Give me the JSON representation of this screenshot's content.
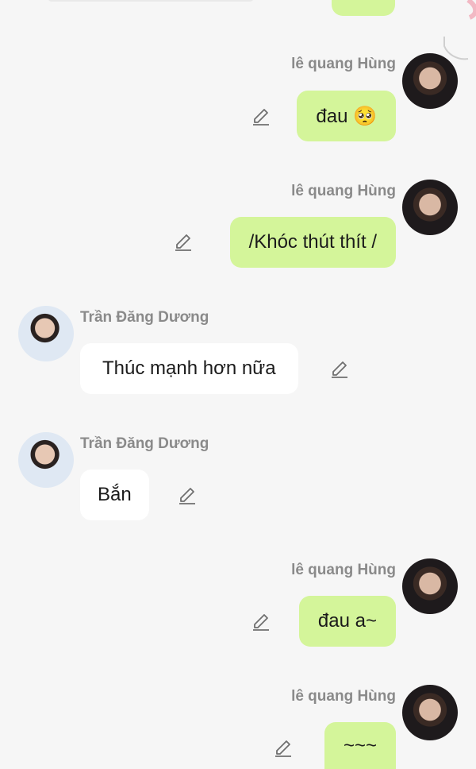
{
  "messages": [
    {
      "side": "right",
      "sender": "lê quang Hùng",
      "text": "đau 🥺"
    },
    {
      "side": "right",
      "sender": "lê quang Hùng",
      "text": "/Khóc thút thít /"
    },
    {
      "side": "left",
      "sender": "Trần Đăng Dương",
      "text": "Thúc mạnh hơn nữa"
    },
    {
      "side": "left",
      "sender": "Trần Đăng Dương",
      "text": "Bắn"
    },
    {
      "side": "right",
      "sender": "lê quang Hùng",
      "text": "đau a~"
    },
    {
      "side": "right",
      "sender": "lê quang Hùng",
      "text": "~~~"
    }
  ],
  "colors": {
    "background": "#f6f6f6",
    "self_bubble": "#d4f59a",
    "other_bubble": "#ffffff",
    "sender_name": "#8a8a8a",
    "edit_icon": "#6f6f6f"
  },
  "icons": {
    "edit": "pencil-edit-icon",
    "avatar_hung": "avatar-le-quang-hung",
    "avatar_duong": "avatar-tran-dang-duong"
  }
}
